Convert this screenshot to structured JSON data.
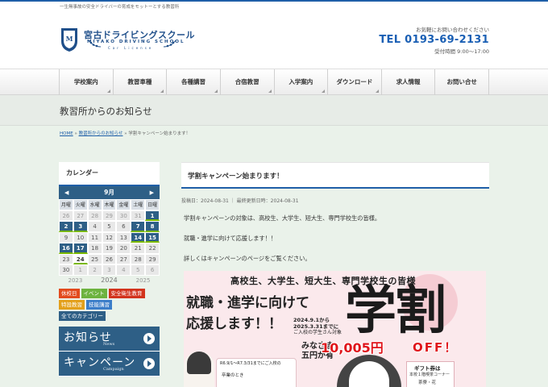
{
  "topbar": {
    "tagline": "一生無事故の安全ドライバーの育成をモットーとする教習所"
  },
  "header": {
    "logo_jp": "宮古ドライビングスクール",
    "logo_en": "MIYAKO DRIVING SCHOOL",
    "logo_sub": "Car  License",
    "contact_label": "お気軽にお問い合わせください",
    "tel": "TEL 0193-69-2131",
    "hours": "受付時間 9:00〜17:00"
  },
  "nav": {
    "items": [
      "学校案内",
      "教習車種",
      "各種講習",
      "合宿教習",
      "入学案内",
      "ダウンロード",
      "求人情報",
      "お問い合せ"
    ]
  },
  "page": {
    "title": "教習所からのお知らせ"
  },
  "breadcrumb": {
    "home": "HOME",
    "sep1": "»",
    "section": "教習所からのお知らせ",
    "sep2": "»",
    "current": "学割キャンペーン始まります！"
  },
  "calendar": {
    "heading": "カレンダー",
    "month": "9月",
    "prev_icon": "◀",
    "next_icon": "▶",
    "weekdays": [
      "月曜",
      "火曜",
      "水曜",
      "木曜",
      "金曜",
      "土曜",
      "日曜"
    ],
    "years": {
      "prev": "2023",
      "current": "2024",
      "next": "2025"
    }
  },
  "tags": [
    {
      "label": "休校日",
      "color": "#e24a1c"
    },
    {
      "label": "イベント",
      "color": "#6db33f"
    },
    {
      "label": "安全衛生教育",
      "color": "#d2341d"
    },
    {
      "label": "特設教習",
      "color": "#e3a01b"
    },
    {
      "label": "技能講習",
      "color": "#3b7dc9"
    },
    {
      "label": "全てのカテゴリー",
      "color": "#2e5f86"
    }
  ],
  "banners": [
    {
      "jp": "お知らせ",
      "en": "News"
    },
    {
      "jp": "キャンペーン",
      "en": "Campaign"
    }
  ],
  "post": {
    "title": "学割キャンペーン始まります！",
    "meta": "投稿日：2024-08-31 ｜ 最終更新日時：2024-08-31",
    "p1": "学割キャンペーンの対象は、高校生、大学生、短大生、専門学校生の皆様。",
    "p2": "就職・進学に向けて応援します！！",
    "p3": "詳しくはキャンペーンのページをご覧ください。"
  },
  "promo": {
    "headline": "高校生、大学生、短大生、専門学校生の皆様",
    "line1": "就職・進学に向けて",
    "line2": "応援します！！",
    "date1": "2024.9.1から",
    "date2": "2025.3.31までに",
    "date3": "ご入校の学生さん対象",
    "big": "学割",
    "amount": "10,005円",
    "off": "OFF！",
    "mina": "みなさま",
    "go": "五円が有",
    "bubble1": "R6.9/1〜R7.3/31までにご入校の",
    "bubble2": "卒業のとき",
    "gift_title": "ギフト券は",
    "gift_line": "本校１階喫茶コーナー",
    "gift_line2": "茶寮・花"
  },
  "colors": {
    "accent": "#1f5fa8",
    "brand_dark": "#2e5f86",
    "page_bg": "#eaf2ea",
    "promo_red": "#e0151b"
  }
}
